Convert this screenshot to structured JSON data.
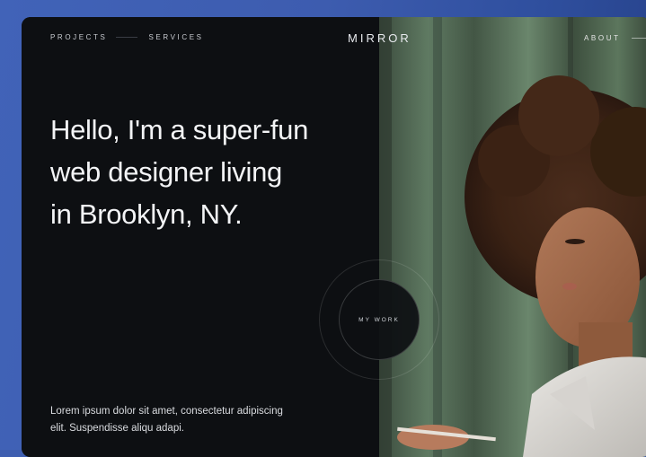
{
  "nav": {
    "projects": "PROJECTS",
    "services": "SERVICES",
    "logo": "MIRROR",
    "about": "ABOUT"
  },
  "hero": {
    "headline": [
      "Hello, I'm a super-fun",
      "web designer living",
      "in Brooklyn, NY."
    ],
    "intro": "Lorem ipsum dolor sit amet, consectetur adipiscing elit. Suspendisse aliqu adapi.",
    "cta": "MY WORK"
  },
  "colors": {
    "background": "#3e5eb0",
    "card": "#0d0f12",
    "text": "#f3f4f6",
    "curtain": "#556b58"
  }
}
